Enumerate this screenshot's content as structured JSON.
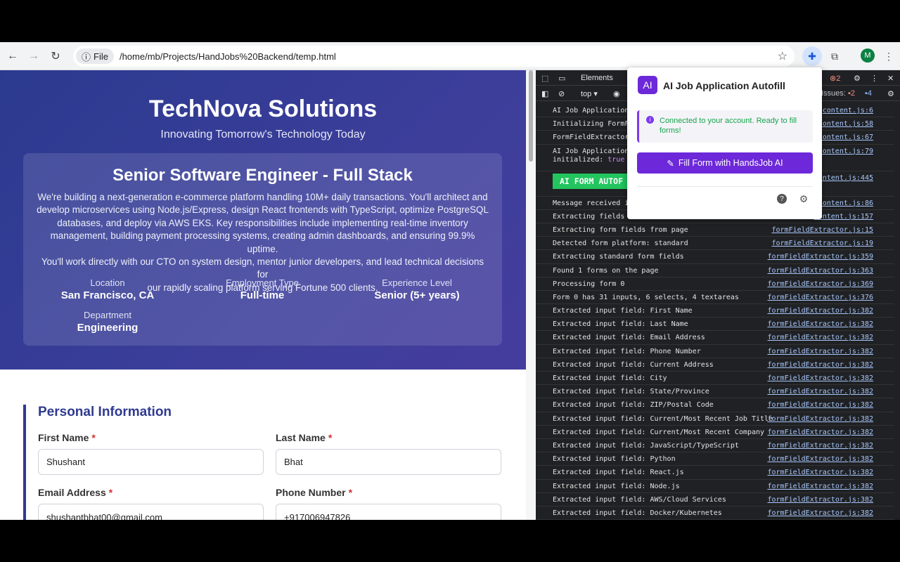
{
  "browser": {
    "file_chip": "File",
    "url": "/home/mb/Projects/HandJobs%20Backend/temp.html",
    "avatar_letter": "M"
  },
  "page": {
    "company": "TechNova Solutions",
    "tagline": "Innovating Tomorrow's Technology Today",
    "job_title": "Senior Software Engineer - Full Stack",
    "job_desc_lines": [
      "We're building a next-generation e-commerce platform handling 10M+ daily transactions. You'll architect and",
      "develop microservices using Node.js/Express, design React frontends with TypeScript, optimize PostgreSQL",
      "databases, and deploy via AWS EKS. Key responsibilities include implementing real-time inventory",
      "management, building payment processing systems, creating admin dashboards, and ensuring 99.9% uptime.",
      "You'll work directly with our CTO on system design, mentor junior developers, and lead technical decisions for",
      "our rapidly scaling platform serving Fortune 500 clients."
    ],
    "meta": [
      {
        "label": "Location",
        "value": "San Francisco, CA"
      },
      {
        "label": "Employment Type",
        "value": "Full-time"
      },
      {
        "label": "Experience Level",
        "value": "Senior (5+ years)"
      },
      {
        "label": "Department",
        "value": "Engineering"
      }
    ],
    "section_title": "Personal Information",
    "required_mark": "*",
    "fields": [
      {
        "label": "First Name",
        "value": "Shushant"
      },
      {
        "label": "Last Name",
        "value": "Bhat"
      },
      {
        "label": "Email Address",
        "value": "shushantbhat00@gmail.com"
      },
      {
        "label": "Phone Number",
        "value": "+917006947826"
      }
    ]
  },
  "devtools": {
    "tab_elements": "Elements",
    "context": "top ▾",
    "issues_label": "Issues:",
    "error_count": "2",
    "issues_err": "2",
    "issues_msg": "4",
    "console_rows": [
      {
        "msg": "AI Job Application",
        "src": "content.js:6"
      },
      {
        "msg": "Initializing FormFi",
        "src": "content.js:58"
      },
      {
        "msg": "FormFieldExtractor",
        "src": "content.js:67"
      },
      {
        "msg": "AI Job Application",
        "src": "content.js:79",
        "msg2": "initialized:",
        "kw": "true"
      },
      {
        "banner": "AI FORM AUTOF",
        "src": "content.js:445"
      },
      {
        "msg": "Message received i",
        "src": "content.js:86"
      },
      {
        "msg": "Extracting fields f",
        "src": "content.js:157"
      },
      {
        "msg": "Extracting form fields from page",
        "src": "formFieldExtractor.js:15"
      },
      {
        "msg": "Detected form platform: standard",
        "src": "formFieldExtractor.js:19"
      },
      {
        "msg": "Extracting standard form fields",
        "src": "formFieldExtractor.js:359"
      },
      {
        "msg": "Found 1 forms on the page",
        "src": "formFieldExtractor.js:363"
      },
      {
        "msg": "Processing form 0",
        "src": "formFieldExtractor.js:369"
      },
      {
        "msg": "Form 0 has 31 inputs, 6 selects, 4 textareas",
        "src": "formFieldExtractor.js:376"
      },
      {
        "msg": "Extracted input field: First Name",
        "src": "formFieldExtractor.js:382"
      },
      {
        "msg": "Extracted input field: Last Name",
        "src": "formFieldExtractor.js:382"
      },
      {
        "msg": "Extracted input field: Email Address",
        "src": "formFieldExtractor.js:382"
      },
      {
        "msg": "Extracted input field: Phone Number",
        "src": "formFieldExtractor.js:382"
      },
      {
        "msg": "Extracted input field: Current Address",
        "src": "formFieldExtractor.js:382"
      },
      {
        "msg": "Extracted input field: City",
        "src": "formFieldExtractor.js:382"
      },
      {
        "msg": "Extracted input field: State/Province",
        "src": "formFieldExtractor.js:382"
      },
      {
        "msg": "Extracted input field: ZIP/Postal Code",
        "src": "formFieldExtractor.js:382"
      },
      {
        "msg": "Extracted input field: Current/Most Recent Job Title",
        "src": "formFieldExtractor.js:382"
      },
      {
        "msg": "Extracted input field: Current/Most Recent Company",
        "src": "formFieldExtractor.js:382"
      },
      {
        "msg": "Extracted input field: JavaScript/TypeScript",
        "src": "formFieldExtractor.js:382"
      },
      {
        "msg": "Extracted input field: Python",
        "src": "formFieldExtractor.js:382"
      },
      {
        "msg": "Extracted input field: React.js",
        "src": "formFieldExtractor.js:382"
      },
      {
        "msg": "Extracted input field: Node.js",
        "src": "formFieldExtractor.js:382"
      },
      {
        "msg": "Extracted input field: AWS/Cloud Services",
        "src": "formFieldExtractor.js:382"
      },
      {
        "msg": "Extracted input field: Docker/Kubernetes",
        "src": "formFieldExtractor.js:382"
      }
    ]
  },
  "popup": {
    "logo": "AI",
    "title": "AI Job Application Autofill",
    "status": "Connected to your account. Ready to fill forms!",
    "button": "Fill Form with HandsJob AI"
  },
  "colors": {
    "hero": "#3c3e9a",
    "accent": "#6d28d9",
    "status_text": "#16a34a",
    "banner": "#22c55e"
  }
}
